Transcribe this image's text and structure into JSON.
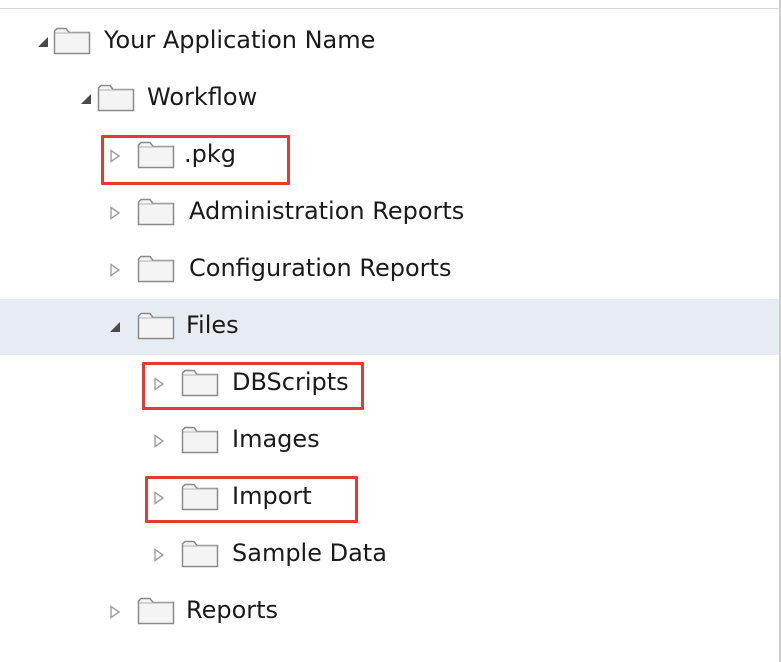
{
  "tree": {
    "root": {
      "label": "Your Application Name",
      "expanded": true
    },
    "workflow": {
      "label": "Workflow",
      "expanded": true
    },
    "pkg": {
      "label": ".pkg",
      "expanded": false,
      "highlighted": true
    },
    "admin_reports": {
      "label": "Administration Reports",
      "expanded": false
    },
    "config_reports": {
      "label": "Configuration Reports",
      "expanded": false
    },
    "files": {
      "label": "Files",
      "expanded": true,
      "selected": true
    },
    "dbscripts": {
      "label": "DBScripts",
      "expanded": false,
      "highlighted": true
    },
    "images": {
      "label": "Images",
      "expanded": false
    },
    "import": {
      "label": "Import",
      "expanded": false,
      "highlighted": true
    },
    "sample_data": {
      "label": "Sample Data",
      "expanded": false
    },
    "reports": {
      "label": "Reports",
      "expanded": false
    }
  },
  "icons": {
    "expanded_toggle": "triangle-down-right-icon",
    "collapsed_toggle": "triangle-right-icon",
    "folder": "folder-icon"
  },
  "colors": {
    "selected_row": "#e6ecf2",
    "highlight_border": "#e53935",
    "folder_fill": "#f4f4f4",
    "folder_stroke": "#8a8a8a",
    "expanded_toggle": "#4a4a4a",
    "collapsed_toggle": "#9e9e9e"
  }
}
